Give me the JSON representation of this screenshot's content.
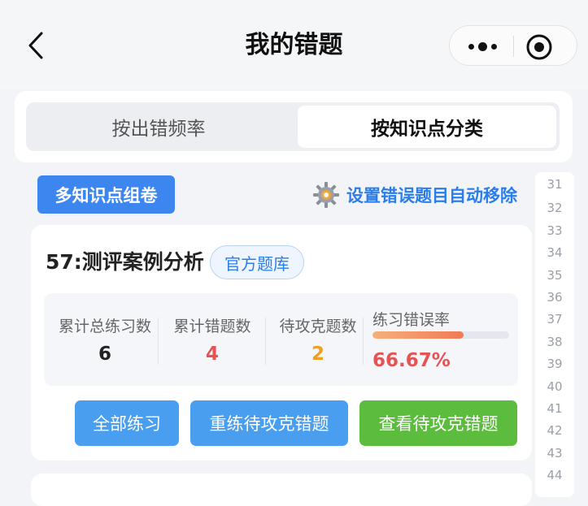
{
  "nav": {
    "title": "我的错题",
    "back_icon": "chevron-left-icon",
    "more_icon": "more-dots-icon",
    "close_icon": "target-close-icon"
  },
  "tabs": [
    {
      "label": "按出错频率",
      "active": false
    },
    {
      "label": "按知识点分类",
      "active": true
    }
  ],
  "actions": {
    "multi_button": "多知识点组卷",
    "settings_label": "设置错误题目自动移除",
    "settings_icon": "gear-icon"
  },
  "rail_numbers": [
    "31",
    "32",
    "33",
    "34",
    "35",
    "36",
    "37",
    "38",
    "39",
    "40",
    "41",
    "42",
    "43",
    "44"
  ],
  "card": {
    "title": "57:测评案例分析",
    "tag": "官方题库",
    "stats": [
      {
        "label": "累计总练习数",
        "value": "6"
      },
      {
        "label": "累计错题数",
        "value": "4"
      },
      {
        "label": "待攻克题数",
        "value": "2"
      }
    ],
    "rate": {
      "label": "练习错误率",
      "value": "66.67%",
      "fraction": 0.6667
    },
    "buttons": {
      "all_practice": "全部练习",
      "redo": "重练待攻克错题",
      "view": "查看待攻克错题"
    }
  },
  "colors": {
    "accent": "#3d86f0",
    "link": "#2b7de9",
    "danger": "#e55353",
    "warning": "#f0a020",
    "success": "#5cbc3d"
  }
}
